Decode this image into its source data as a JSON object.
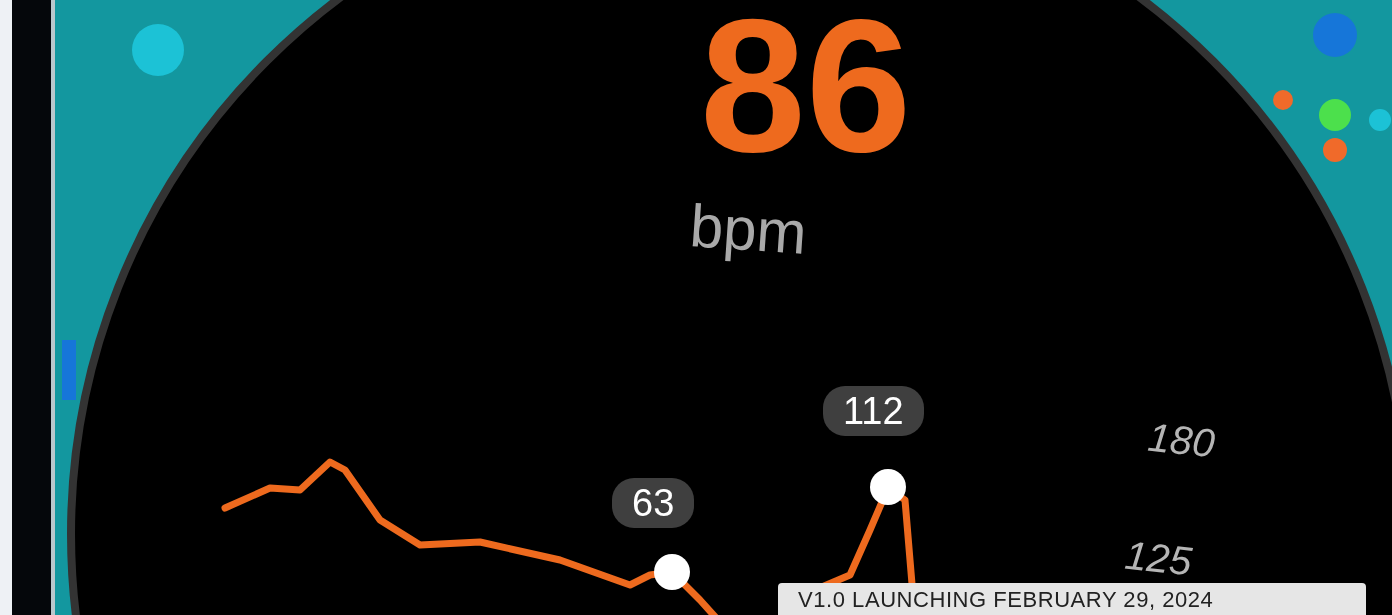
{
  "heart_rate": {
    "value": "86",
    "unit": "bpm"
  },
  "graph": {
    "point_labels": [
      {
        "text": "63"
      },
      {
        "text": "112"
      }
    ],
    "scale_labels": [
      "180",
      "125"
    ]
  },
  "banner": {
    "text": "V1.0 LAUNCHING FEBRUARY 29, 2024"
  }
}
